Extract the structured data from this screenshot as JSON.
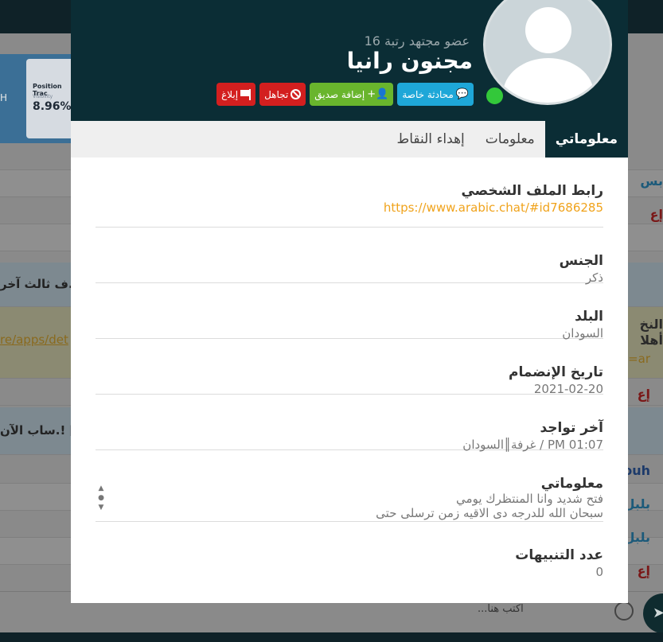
{
  "background": {
    "banner_title": "Position Trac",
    "banner_sub": "Visibility",
    "banner_value": "8.96%",
    "banner_edge_text": "H",
    "row_snippet_1": "ف ثالث آخر..",
    "row_link": "re/apps/det",
    "row_snippet_2": "ساب الآن.! [",
    "side_texts": [
      "بس",
      "إع",
      "النخ",
      "أهلا",
      "=ar",
      "إع",
      "ouh",
      "بلبل",
      "بلبل",
      "إع"
    ],
    "input_placeholder": "اكتب هنا..."
  },
  "profile": {
    "rank": "عضو مجتهد رتبة 16",
    "username": "مجنون رانيا",
    "online_color": "#33c83a"
  },
  "actions": {
    "chat": "محادثة خاصة",
    "friend": "إضافة صديق",
    "ignore": "تجاهل",
    "report": "إبلاغ"
  },
  "tabs": [
    {
      "label": "معلوماتي",
      "active": true
    },
    {
      "label": "معلومات",
      "active": false
    },
    {
      "label": "إهداء النقاط",
      "active": false
    }
  ],
  "fields": {
    "profile_link": {
      "label": "رابط الملف الشخصي",
      "value": "https://www.arabic.chat/#id7686285"
    },
    "gender": {
      "label": "الجنس",
      "value": "ذكر"
    },
    "country": {
      "label": "البلد",
      "value": "السودان"
    },
    "joined": {
      "label": "تاريخ الإنضمام",
      "value": "2021-02-20"
    },
    "last_seen": {
      "label": "آخر تواجد",
      "value": "01:07 PM / غرفة║السودان"
    },
    "about": {
      "label": "معلوماتي",
      "line1": "فتح شديد وانا المنتظرك يومي",
      "line2": "سبحان الله للدرجه دى الاقيه زمن ترسلى حتى"
    },
    "warnings": {
      "label": "عدد التنبيهات",
      "value": "0"
    }
  },
  "colors": {
    "header_bg": "#0b2d35",
    "link": "#f0a31c",
    "chat_button": "#1ea7d8",
    "friend_button": "#69b52d",
    "danger_button": "#d31f1f"
  }
}
